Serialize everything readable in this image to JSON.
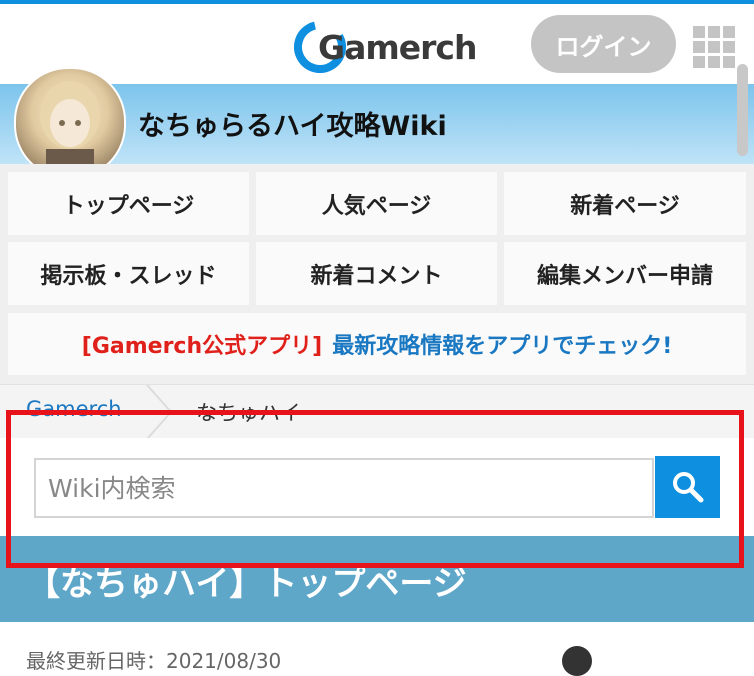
{
  "header": {
    "brand": "Gamerch",
    "login_label": "ログイン",
    "menu_icon": "grid-menu-icon"
  },
  "wiki": {
    "title": "なちゅらるハイ攻略Wiki"
  },
  "nav": {
    "items": [
      {
        "label": "トップページ"
      },
      {
        "label": "人気ページ"
      },
      {
        "label": "新着ページ"
      },
      {
        "label": "掲示板・スレッド"
      },
      {
        "label": "新着コメント"
      },
      {
        "label": "編集メンバー申請"
      }
    ]
  },
  "promo": {
    "tag": "[Gamerch公式アプリ]",
    "text": "最新攻略情報をアプリでチェック!"
  },
  "breadcrumb": {
    "items": [
      "Gamerch",
      "なちゅハイ"
    ]
  },
  "search": {
    "placeholder": "Wiki内検索",
    "icon": "search-icon"
  },
  "page": {
    "title": "【なちゅハイ】トップページ",
    "updated": "最終更新日時：2021/08/30"
  },
  "colors": {
    "accent": "#0f8fe0",
    "highlight": "#e8131a",
    "title_bar": "#5fa7c9",
    "promo_red": "#e0201a",
    "promo_blue": "#1a78c2"
  }
}
